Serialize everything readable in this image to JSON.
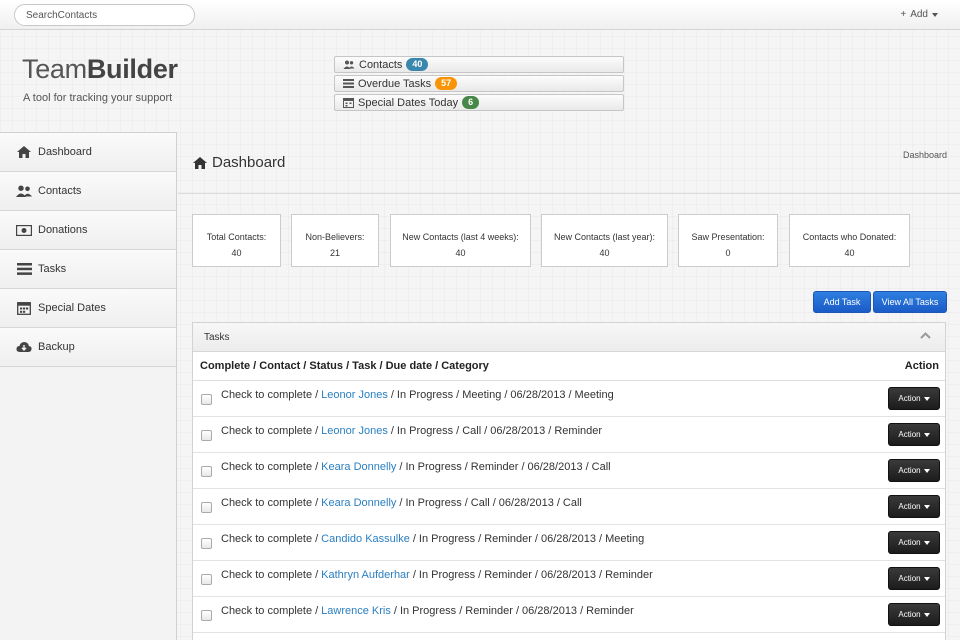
{
  "topbar": {
    "search_placeholder": "SearchContacts",
    "add_label": "Add"
  },
  "header": {
    "brand_light": "Team",
    "brand_bold": "Builder",
    "tagline": "A tool for tracking your support"
  },
  "stats_buttons": [
    {
      "label": "Contacts",
      "count": "40",
      "icon": "users-icon",
      "badge_color": "#3a87ad"
    },
    {
      "label": "Overdue Tasks",
      "count": "57",
      "icon": "list-icon",
      "badge_color": "#f89406"
    },
    {
      "label": "Special Dates Today",
      "count": "6",
      "icon": "calendar-icon",
      "badge_color": "#468847"
    }
  ],
  "sidebar": {
    "items": [
      {
        "label": "Dashboard",
        "icon": "home-icon"
      },
      {
        "label": "Contacts",
        "icon": "users-icon"
      },
      {
        "label": "Donations",
        "icon": "money-icon"
      },
      {
        "label": "Tasks",
        "icon": "list-icon"
      },
      {
        "label": "Special Dates",
        "icon": "calendar-icon"
      },
      {
        "label": "Backup",
        "icon": "cloud-download-icon"
      }
    ]
  },
  "main": {
    "title": "Dashboard",
    "breadcrumb": "Dashboard",
    "stat_boxes": [
      {
        "label": "Total Contacts:",
        "value": "40"
      },
      {
        "label": "Non-Believers:",
        "value": "21"
      },
      {
        "label": "New Contacts (last 4 weeks):",
        "value": "40"
      },
      {
        "label": "New Contacts (last year):",
        "value": "40"
      },
      {
        "label": "Saw Presentation:",
        "value": "0"
      },
      {
        "label": "Contacts who Donated:",
        "value": "40"
      }
    ],
    "add_task_label": "Add Task",
    "view_all_label": "View All Tasks"
  },
  "tasks": {
    "panel_title": "Tasks",
    "columns": "Complete / Contact / Status / Task / Due date / Category",
    "action_header": "Action",
    "complete_text": "Check to complete",
    "action_button": "Action",
    "rows": [
      {
        "contact": "Leonor Jones",
        "status": "In Progress",
        "task": "Meeting",
        "due": "06/28/2013",
        "category": "Meeting"
      },
      {
        "contact": "Leonor Jones",
        "status": "In Progress",
        "task": "Call",
        "due": "06/28/2013",
        "category": "Reminder"
      },
      {
        "contact": "Keara Donnelly",
        "status": "In Progress",
        "task": "Reminder",
        "due": "06/28/2013",
        "category": "Call"
      },
      {
        "contact": "Keara Donnelly",
        "status": "In Progress",
        "task": "Call",
        "due": "06/28/2013",
        "category": "Call"
      },
      {
        "contact": "Candido Kassulke",
        "status": "In Progress",
        "task": "Reminder",
        "due": "06/28/2013",
        "category": "Meeting"
      },
      {
        "contact": "Kathryn Aufderhar",
        "status": "In Progress",
        "task": "Reminder",
        "due": "06/28/2013",
        "category": "Reminder"
      },
      {
        "contact": "Lawrence Kris",
        "status": "In Progress",
        "task": "Reminder",
        "due": "06/28/2013",
        "category": "Reminder"
      }
    ]
  }
}
